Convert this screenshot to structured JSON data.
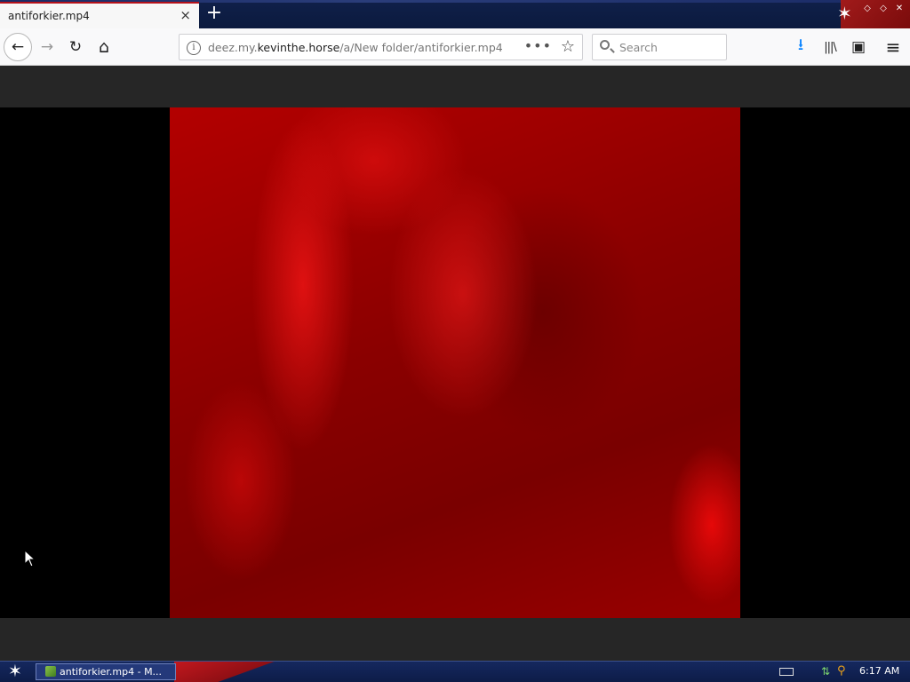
{
  "browser": {
    "tab": {
      "title": "antiforkier.mp4",
      "close_icon": "×"
    },
    "new_tab_icon": "+",
    "nav": {
      "back_icon": "←",
      "forward_icon": "→",
      "reload_icon": "↻",
      "home_icon": "⌂"
    },
    "url": {
      "prefix": "deez.my.",
      "domain": "kevinthe.horse",
      "path": "/a/New folder/antiforkier.mp4",
      "info_icon": "i",
      "more_icon": "•••",
      "bookmark_icon": "☆"
    },
    "search": {
      "placeholder": "Search"
    },
    "toolbar": {
      "download_icon": "⭳",
      "library_icon": "|||\\",
      "sidebar_icon": "▣",
      "menu_icon": "≡"
    }
  },
  "taskbar": {
    "start_icon": "✶",
    "task_label": "antiforkier.mp4 - M...",
    "clock": "6:17 AM"
  },
  "colors": {
    "tab_accent": "#b5121b",
    "taskbar_bg": "#15285e",
    "video_tint": "#b30000"
  }
}
